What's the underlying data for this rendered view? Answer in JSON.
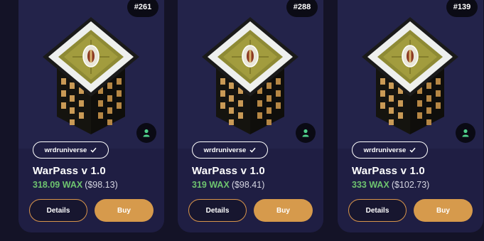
{
  "colors": {
    "card_bg": "#1f1e43",
    "art_bg": "#23234a",
    "price_green": "#6ec46f",
    "accent_orange": "#d69a4c"
  },
  "cards": [
    {
      "badge": "#261",
      "collection": "wrdruniverse",
      "title": "WarPass v 1.0",
      "price_wax": "318.09 WAX",
      "price_usd": "($98.13)",
      "details_label": "Details",
      "buy_label": "Buy",
      "verified_icon": "check-icon",
      "owner_icon": "user-icon"
    },
    {
      "badge": "#288",
      "collection": "wrdruniverse",
      "title": "WarPass v 1.0",
      "price_wax": "319 WAX",
      "price_usd": "($98.41)",
      "details_label": "Details",
      "buy_label": "Buy",
      "verified_icon": "check-icon",
      "owner_icon": "user-icon"
    },
    {
      "badge": "#139",
      "collection": "wrdruniverse",
      "title": "WarPass v 1.0",
      "price_wax": "333 WAX",
      "price_usd": "($102.73)",
      "details_label": "Details",
      "buy_label": "Buy",
      "verified_icon": "check-icon",
      "owner_icon": "user-icon"
    }
  ]
}
